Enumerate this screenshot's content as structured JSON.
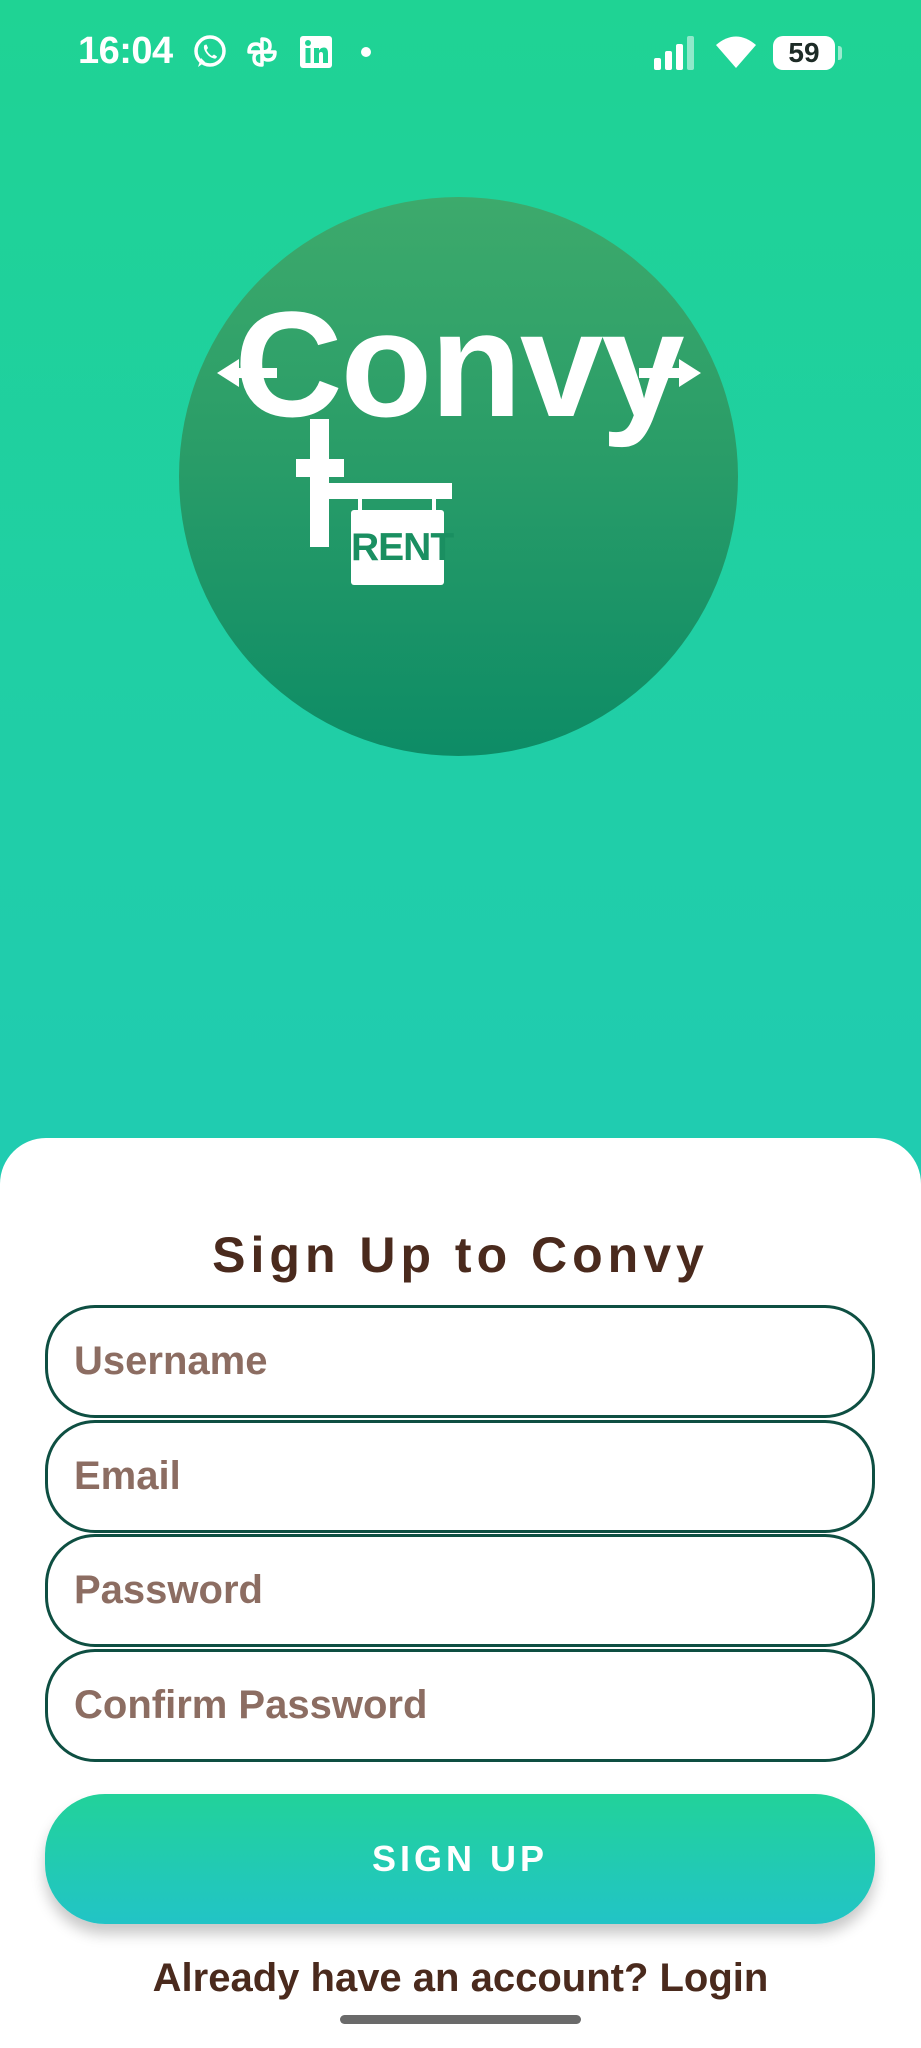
{
  "status_bar": {
    "time": "16:04",
    "notification_icons": [
      "whatsapp-icon",
      "pinwheel-icon",
      "linkedin-icon",
      "dot-icon"
    ],
    "system_icons": [
      "signal-icon",
      "wifi-icon",
      "battery-icon"
    ],
    "battery_level": "59"
  },
  "logo": {
    "wordmark": "Convy",
    "sign_text": "RENT",
    "circle_color": "#2a9d68"
  },
  "signup": {
    "title": "Sign Up to Convy",
    "fields": [
      {
        "name": "username",
        "placeholder": "Username",
        "value": ""
      },
      {
        "name": "email",
        "placeholder": "Email",
        "value": ""
      },
      {
        "name": "password",
        "placeholder": "Password",
        "value": ""
      },
      {
        "name": "confirm_password",
        "placeholder": "Confirm Password",
        "value": ""
      }
    ],
    "submit_label": "SIGN UP",
    "login_prompt": "Already have an account? Login"
  },
  "colors": {
    "background_top": "#1fd394",
    "background_bottom": "#22c4c4",
    "title_text": "#4a2a1d",
    "placeholder_text": "#8c6d62",
    "field_border": "#0e4f42",
    "button_top": "#22d29a",
    "button_bottom": "#22c4c6"
  }
}
